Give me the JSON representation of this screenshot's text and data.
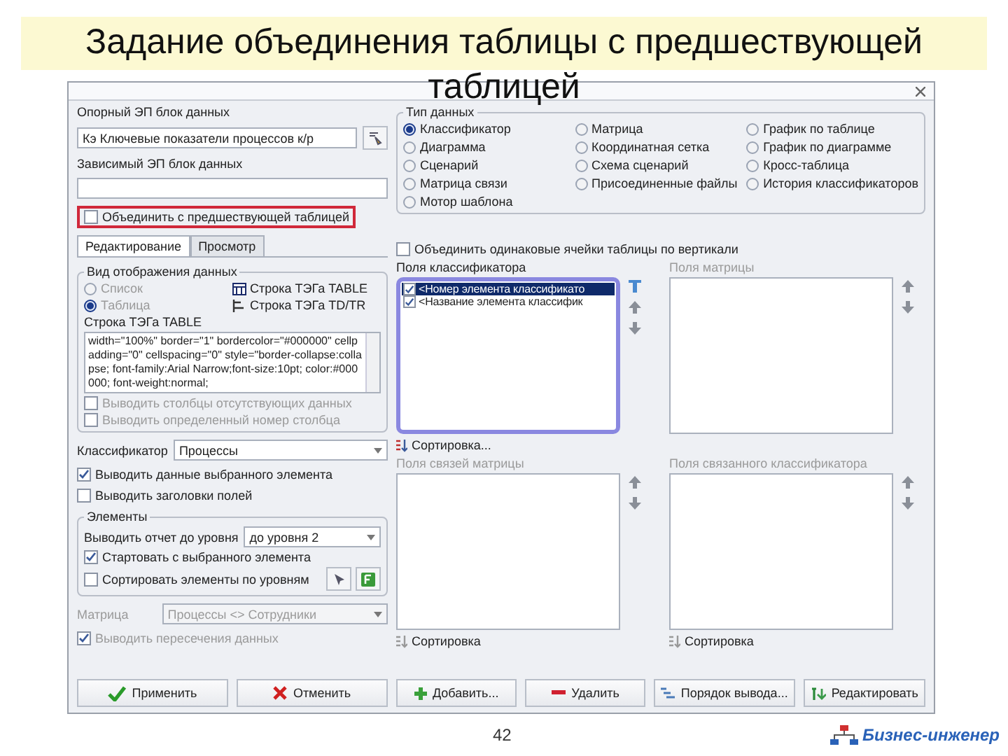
{
  "slide": {
    "title": "Задание объединения таблицы с предшествующей таблицей",
    "page": "42",
    "logo": "Бизнес-инженер"
  },
  "left": {
    "source": {
      "label": "Опорный ЭП блок данных",
      "value": "Кэ Ключевые показатели процессов к/р"
    },
    "dependent": {
      "label": "Зависимый ЭП блок данных"
    },
    "merge": {
      "label": "Объединить с предшествующей таблицей",
      "checked": false,
      "highlighted": true
    },
    "tabs": [
      {
        "label": "Редактирование",
        "selected": true
      },
      {
        "label": "Просмотр",
        "selected": false
      }
    ],
    "view_group": {
      "title": "Вид отображения данных",
      "options": [
        {
          "label": "Список",
          "selected": false,
          "disabled": true
        },
        {
          "label": "Таблица",
          "selected": true,
          "disabled": true
        }
      ],
      "buttons": [
        "Строка ТЭГа TABLE",
        "Строка ТЭГа TD/TR"
      ],
      "tag_label": "Строка ТЭГа TABLE",
      "tag_text": "width=\"100%\" border=\"1\" bordercolor=\"#000000\" cellpadding=\"0\" cellspacing=\"0\" style=\"border-collapse:collapse; font-family:Arial Narrow;font-size:10pt; color:#000000; font-weight:normal;",
      "checks": [
        {
          "label": "Выводить столбцы отсутствующих данных",
          "checked": false,
          "disabled": true
        },
        {
          "label": "Выводить определенный номер столбца",
          "checked": false,
          "disabled": true
        }
      ]
    },
    "classifier": {
      "label": "Классификатор",
      "value": "Процессы"
    },
    "options": [
      {
        "label": "Выводить данные выбранного элемента",
        "checked": true
      },
      {
        "label": "Выводить заголовки полей",
        "checked": false
      }
    ],
    "elements_group": {
      "title": "Элементы",
      "level_label": "Выводить отчет до уровня",
      "level_value": "до уровня 2",
      "checks": [
        {
          "label": "Стартовать с выбранного элемента",
          "checked": true
        },
        {
          "label": "Сортировать элементы по уровням",
          "checked": false
        }
      ]
    },
    "matrix": {
      "label": "Матрица",
      "value": "Процессы <> Сотрудники",
      "disabled": true
    },
    "matrix_option": {
      "label": "Выводить пересечения данных",
      "checked": true,
      "disabled": true
    },
    "buttons": [
      {
        "label": "Применить",
        "kind": "apply"
      },
      {
        "label": "Отменить",
        "kind": "cancel"
      }
    ]
  },
  "right": {
    "data_type": {
      "title": "Тип данных",
      "options": [
        {
          "label": "Классификатор",
          "selected": true
        },
        {
          "label": "Матрица",
          "selected": false
        },
        {
          "label": "График по таблице",
          "selected": false
        },
        {
          "label": "Диаграмма",
          "selected": false
        },
        {
          "label": "Координатная сетка",
          "selected": false
        },
        {
          "label": "График по диаграмме",
          "selected": false
        },
        {
          "label": "Сценарий",
          "selected": false
        },
        {
          "label": "Схема сценарий",
          "selected": false
        },
        {
          "label": "Кросс-таблица",
          "selected": false
        },
        {
          "label": "Матрица связи",
          "selected": false
        },
        {
          "label": "Присоединенные файлы",
          "selected": false
        },
        {
          "label": "История классификаторов",
          "selected": false
        },
        {
          "label": "Мотор шаблона",
          "selected": false
        }
      ]
    },
    "merge_cells": {
      "label": "Объединить одинаковые ячейки таблицы по вертикали",
      "checked": false
    },
    "lists": [
      {
        "title": "Поля классификатора",
        "disabled": false,
        "focused": true,
        "filter": true,
        "sort": {
          "label": "Сортировка...",
          "disabled": false
        },
        "items": [
          {
            "label": "<Номер элемента классификато",
            "checked": true,
            "selected": true
          },
          {
            "label": "<Название элемента классифик",
            "checked": true,
            "selected": false
          }
        ]
      },
      {
        "title": "Поля матрицы",
        "disabled": true,
        "focused": false,
        "filter": false
      },
      {
        "title": "Поля связей матрицы",
        "disabled": true,
        "focused": false,
        "filter": false,
        "sort": {
          "label": "Сортировка",
          "disabled": true
        }
      },
      {
        "title": "Поля связанного классификатора",
        "disabled": true,
        "focused": false,
        "filter": false,
        "sort": {
          "label": "Сортировка",
          "disabled": true
        }
      }
    ],
    "buttons": [
      {
        "label": "Добавить...",
        "kind": "add"
      },
      {
        "label": "Удалить",
        "kind": "remove"
      },
      {
        "label": "Порядок вывода...",
        "kind": "order"
      },
      {
        "label": "Редактировать",
        "kind": "edit"
      }
    ]
  }
}
